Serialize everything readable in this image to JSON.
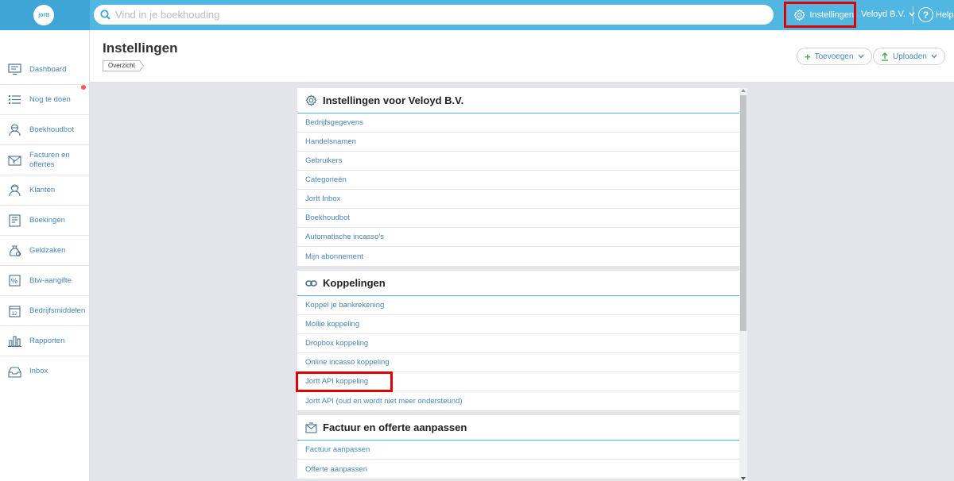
{
  "app": {
    "logo_text": "jortt",
    "search_placeholder": "Vind in je boekhouding"
  },
  "topbar": {
    "settings_label": "Instellingen",
    "user_label": "Veloyd B.V.",
    "help_label": "Help"
  },
  "sidebar": {
    "items": [
      {
        "label": "Dashboard",
        "icon": "monitor-icon"
      },
      {
        "label": "Nog te doen",
        "icon": "list-icon"
      },
      {
        "label": "Boekhoudbot",
        "icon": "bot-icon"
      },
      {
        "label": "Facturen en offertes",
        "icon": "invoice-icon"
      },
      {
        "label": "Klanten",
        "icon": "customer-icon"
      },
      {
        "label": "Boekingen",
        "icon": "ledger-icon"
      },
      {
        "label": "Geldzaken",
        "icon": "money-bag-icon"
      },
      {
        "label": "Btw-aangifte",
        "icon": "percent-icon"
      },
      {
        "label": "Bedrijfsmiddelen",
        "icon": "calendar-icon"
      },
      {
        "label": "Rapporten",
        "icon": "bar-chart-icon"
      },
      {
        "label": "Inbox",
        "icon": "inbox-icon"
      }
    ]
  },
  "header": {
    "title": "Instellingen",
    "breadcrumb": "Overzicht",
    "add_label": "Toevoegen",
    "upload_label": "Uploaden"
  },
  "sections": [
    {
      "title": "Instellingen voor Veloyd B.V.",
      "icon": "gear-icon",
      "items": [
        "Bedrijfsgegevens",
        "Handelsnamen",
        "Gebruikers",
        "Categorieën",
        "Jortt Inbox",
        "Boekhoudbot",
        "Automatische incasso's",
        "Mijn abonnement"
      ]
    },
    {
      "title": "Koppelingen",
      "icon": "link-icon",
      "items": [
        "Koppel je bankrekening",
        "Mollie koppeling",
        "Dropbox koppeling",
        "Online incasso koppeling",
        "Jortt API koppeling",
        "Jortt API (oud en wordt niet meer ondersteund)"
      ]
    },
    {
      "title": "Factuur en offerte aanpassen",
      "icon": "invoice-edit-icon",
      "items": [
        "Factuur aanpassen",
        "Offerte aanpassen"
      ]
    }
  ],
  "colors": {
    "topbar": "#52b6e2",
    "accent_link": "#4a86b8",
    "highlight": "#e00000"
  }
}
